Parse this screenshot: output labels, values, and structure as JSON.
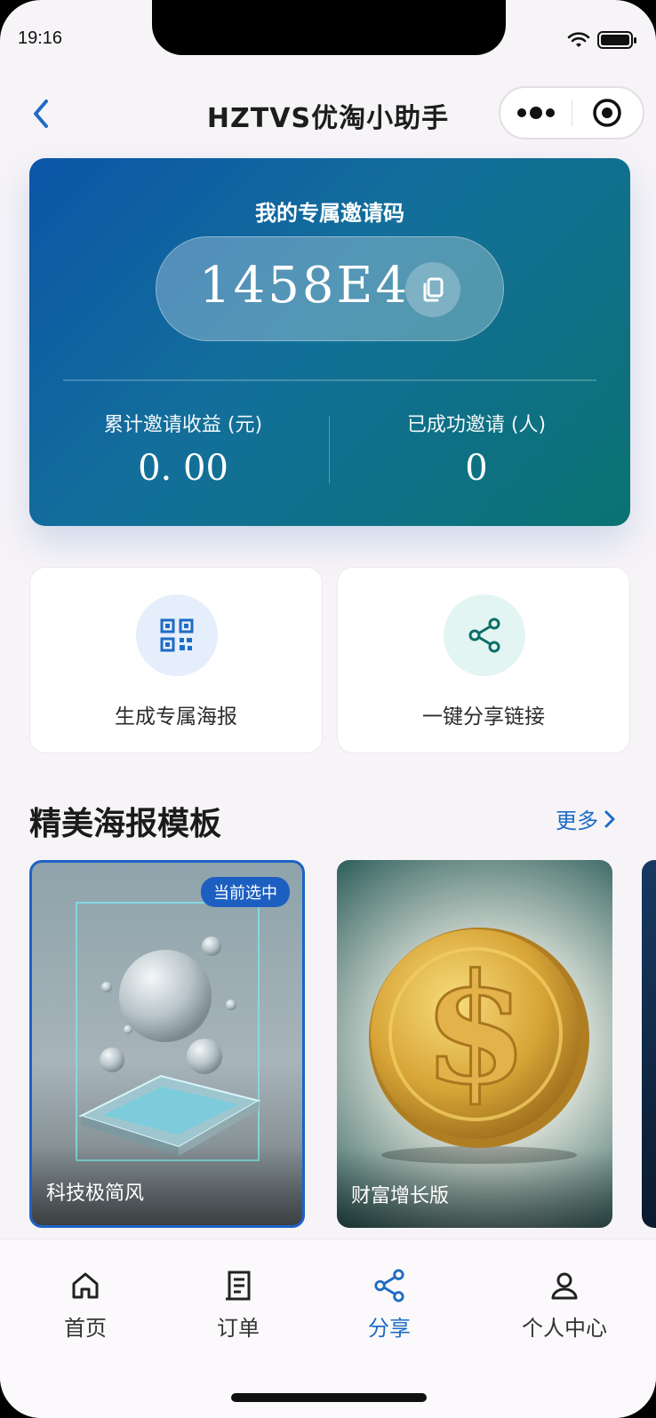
{
  "status_bar": {
    "time": "19:16"
  },
  "nav": {
    "title": "HZTVS优淘小助手",
    "back_icon": "chevron-left-icon",
    "menu_icon": "more-dots-icon",
    "close_icon": "target-circle-icon"
  },
  "invite_card": {
    "title": "我的专属邀请码",
    "code": "1458E4",
    "copy_icon": "copy-icon",
    "stats": [
      {
        "label": "累计邀请收益 (元)",
        "value": "0. 00"
      },
      {
        "label": "已成功邀请 (人)",
        "value": "0"
      }
    ]
  },
  "actions": [
    {
      "label": "生成专属海报",
      "icon": "qrcode-icon",
      "icon_bg": "#e5eefb",
      "icon_color": "#1e6cc4"
    },
    {
      "label": "一键分享链接",
      "icon": "share-icon",
      "icon_bg": "#e2f5f2",
      "icon_color": "#0e6e68"
    }
  ],
  "templates_section": {
    "title": "精美海报模板",
    "more": "更多",
    "items": [
      {
        "name": "科技极简风",
        "badge": "当前选中",
        "selected": true
      },
      {
        "name": "财富增长版",
        "selected": false
      }
    ]
  },
  "tabbar": {
    "active_color": "#1e6cc4",
    "items": [
      {
        "label": "首页",
        "icon": "home-icon"
      },
      {
        "label": "订单",
        "icon": "receipt-icon"
      },
      {
        "label": "分享",
        "icon": "share-icon",
        "active": true
      },
      {
        "label": "个人中心",
        "icon": "user-icon"
      }
    ]
  }
}
